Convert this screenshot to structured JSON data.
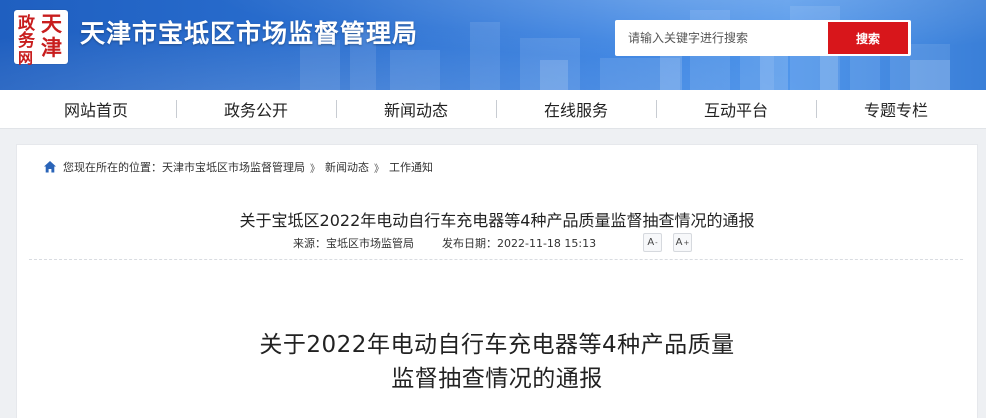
{
  "header": {
    "site_title": "天津市宝坻区市场监督管理局",
    "emblem": {
      "icon": "department-seal-logo",
      "chars": [
        "天",
        "津",
        "政",
        "务",
        "网"
      ],
      "color": "#c81d1d"
    },
    "search": {
      "placeholder": "请输入关键字进行搜索",
      "button_label": "搜索",
      "button_color": "#d8161b"
    }
  },
  "nav": {
    "items": [
      {
        "label": "网站首页"
      },
      {
        "label": "政务公开"
      },
      {
        "label": "新闻动态"
      },
      {
        "label": "在线服务"
      },
      {
        "label": "互动平台"
      },
      {
        "label": "专题专栏"
      }
    ]
  },
  "breadcrumb": {
    "icon": "home-icon",
    "prefix": "您现在所在的位置：",
    "items": [
      "天津市宝坻区市场监督管理局",
      "新闻动态",
      "工作通知"
    ],
    "separator": "》"
  },
  "article": {
    "title": "关于宝坻区2022年电动自行车充电器等4种产品质量监督抽查情况的通报",
    "source_label": "来源：",
    "source": "宝坻区市场监管局",
    "date_label": "发布日期：",
    "date": "2022-11-18 15:13",
    "font_smaller": "A",
    "font_larger": "A",
    "font_smaller_mark": "-",
    "font_larger_mark": "+",
    "heading_lines": [
      "关于2022年电动自行车充电器等4种产品质量",
      "监督抽查情况的通报"
    ]
  }
}
